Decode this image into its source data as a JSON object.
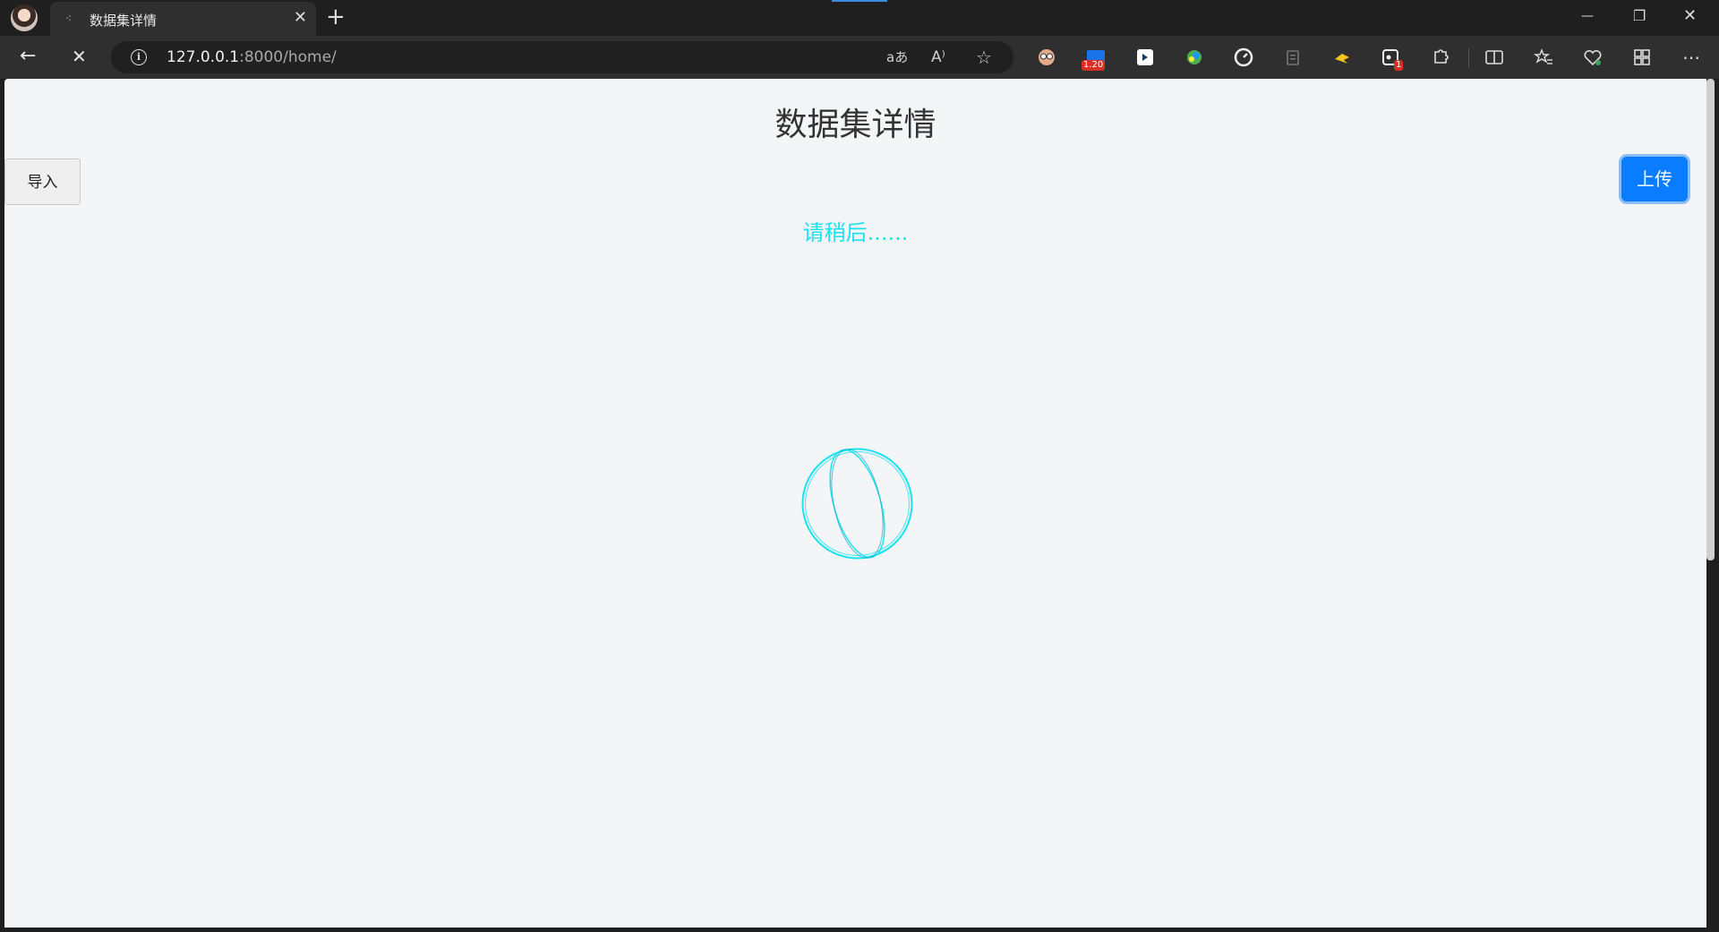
{
  "browser": {
    "tab": {
      "title": "数据集详情",
      "close_glyph": "✕",
      "loading_glyph": "⁖"
    },
    "new_tab_glyph": "+",
    "window_controls": {
      "minimize": "—",
      "restore": "❐",
      "close": "✕"
    },
    "nav": {
      "back_glyph": "←",
      "stop_glyph": "✕"
    },
    "address": {
      "host": "127.0.0.1",
      "path": ":8000/home/",
      "info_glyph": "i"
    },
    "omnibox_icons": [
      "read-aloud-translate-icon",
      "read-aloud-icon",
      "favorite-star-icon"
    ],
    "extensions": [
      {
        "name": "glasses-extension-icon"
      },
      {
        "name": "video-speed-extension-icon",
        "badge": "1.20"
      },
      {
        "name": "dark-extension-icon"
      },
      {
        "name": "color-picker-extension-icon"
      },
      {
        "name": "speedometer-extension-icon"
      },
      {
        "name": "clipboard-extension-icon"
      },
      {
        "name": "yellow-bird-extension-icon"
      },
      {
        "name": "camera-extension-icon",
        "badge": "1"
      },
      {
        "name": "extensions-puzzle-icon"
      },
      {
        "name": "split-screen-icon"
      },
      {
        "name": "favorites-icon"
      },
      {
        "name": "browser-essentials-icon"
      },
      {
        "name": "collections-icon"
      },
      {
        "name": "more-menu-icon"
      }
    ]
  },
  "page": {
    "title": "数据集详情",
    "import_label": "导入",
    "upload_label": "上传",
    "wait_text": "请稍后......",
    "colors": {
      "accent": "#19e3ef",
      "primary": "#0a7cff",
      "background": "#f4f5f7"
    }
  }
}
